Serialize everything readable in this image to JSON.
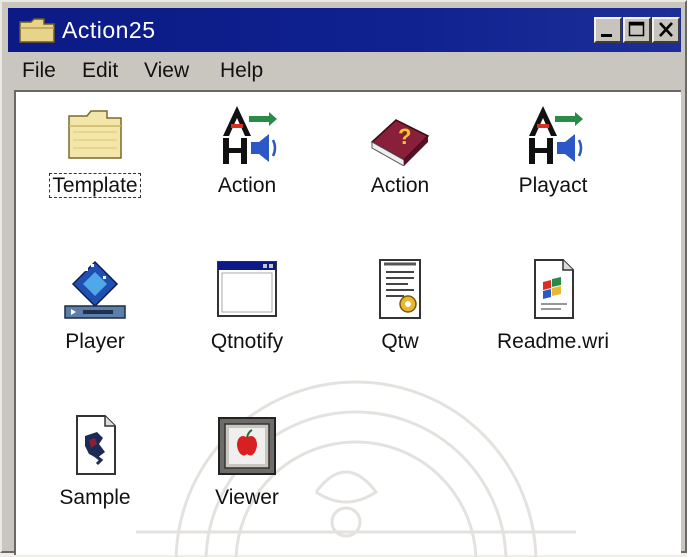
{
  "window": {
    "title": "Action25"
  },
  "menu": [
    {
      "label": "File"
    },
    {
      "label": "Edit"
    },
    {
      "label": "View"
    },
    {
      "label": "Help"
    }
  ],
  "items": [
    {
      "label": "Template",
      "icon": "folder-icon"
    },
    {
      "label": "Action",
      "icon": "action-shortcut-icon"
    },
    {
      "label": "Action",
      "icon": "help-book-icon"
    },
    {
      "label": "Playact",
      "icon": "action-shortcut-icon"
    },
    {
      "label": "Player",
      "icon": "media-player-icon"
    },
    {
      "label": "Qtnotify",
      "icon": "window-app-icon"
    },
    {
      "label": "Qtw",
      "icon": "document-gear-icon"
    },
    {
      "label": "Readme.wri",
      "icon": "write-document-icon"
    },
    {
      "label": "Sample",
      "icon": "sample-document-icon"
    },
    {
      "label": "Viewer",
      "icon": "apple-viewer-icon"
    }
  ],
  "selected_item": "Template"
}
